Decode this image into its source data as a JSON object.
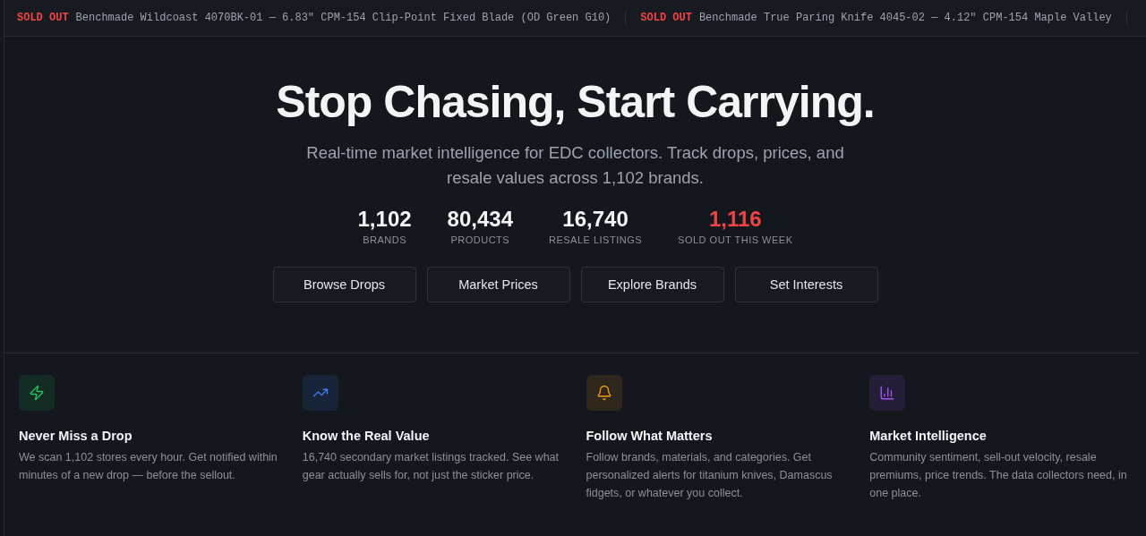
{
  "ticker": [
    {
      "badge": "SOLD OUT",
      "text": "Benchmade Wildcoast 4070BK-01 — 6.83\" CPM-154 Clip-Point Fixed Blade (OD Green G10)"
    },
    {
      "badge": "SOLD OUT",
      "text": "Benchmade True Paring Knife 4045-02 — 4.12\" CPM-154 Maple Valley"
    }
  ],
  "hero": {
    "title": "Stop Chasing, Start Carrying.",
    "subtitle": "Real-time market intelligence for EDC collectors. Track drops, prices, and resale values across 1,102 brands."
  },
  "stats": [
    {
      "value": "1,102",
      "label": "BRANDS",
      "color": "#f3f4f6"
    },
    {
      "value": "80,434",
      "label": "PRODUCTS",
      "color": "#f3f4f6"
    },
    {
      "value": "16,740",
      "label": "RESALE LISTINGS",
      "color": "#f3f4f6"
    },
    {
      "value": "1,116",
      "label": "SOLD OUT THIS WEEK",
      "color": "#ef4444"
    }
  ],
  "buttons": [
    "Browse Drops",
    "Market Prices",
    "Explore Brands",
    "Set Interests"
  ],
  "features": [
    {
      "kind": "bolt",
      "color": "#22c55e",
      "title": "Never Miss a Drop",
      "text": "We scan 1,102 stores every hour. Get notified within minutes of a new drop — before the sellout."
    },
    {
      "kind": "trend",
      "color": "#3b82f6",
      "title": "Know the Real Value",
      "text": "16,740 secondary market listings tracked. See what gear actually sells for, not just the sticker price."
    },
    {
      "kind": "bell",
      "color": "#f59e0b",
      "title": "Follow What Matters",
      "text": "Follow brands, materials, and categories. Get personalized alerts for titanium knives, Damascus fidgets, or whatever you collect."
    },
    {
      "kind": "chart",
      "color": "#a855f7",
      "title": "Market Intelligence",
      "text": "Community sentiment, sell-out velocity, resale premiums, price trends. The data collectors need, in one place."
    }
  ]
}
